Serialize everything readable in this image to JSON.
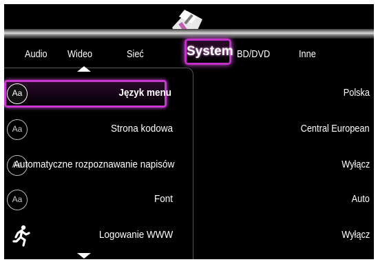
{
  "tabs": [
    {
      "label": "Audio"
    },
    {
      "label": "Wideo"
    },
    {
      "label": "Sieć"
    },
    {
      "label": "System"
    },
    {
      "label": "BD/DVD"
    },
    {
      "label": "Inne"
    }
  ],
  "active_tab": "System",
  "settings": [
    {
      "label": "Język menu",
      "value": "Polska",
      "icon": "aa-icon",
      "icon_text": "Aa"
    },
    {
      "label": "Strona kodowa",
      "value": "Central European",
      "icon": "aa-icon",
      "icon_text": "Aa"
    },
    {
      "label": "Automatyczne rozpoznawanie napisów",
      "value": "Wyłącz",
      "icon": "aa-icon",
      "icon_text": "Aa"
    },
    {
      "label": "Font",
      "value": "Auto",
      "icon": "aa-icon",
      "icon_text": "Aa"
    },
    {
      "label": "Logowanie WWW",
      "value": "Wyłącz",
      "icon": "runner-icon",
      "icon_text": ""
    }
  ],
  "colors": {
    "highlight": "#c838d0",
    "background": "#000000"
  }
}
